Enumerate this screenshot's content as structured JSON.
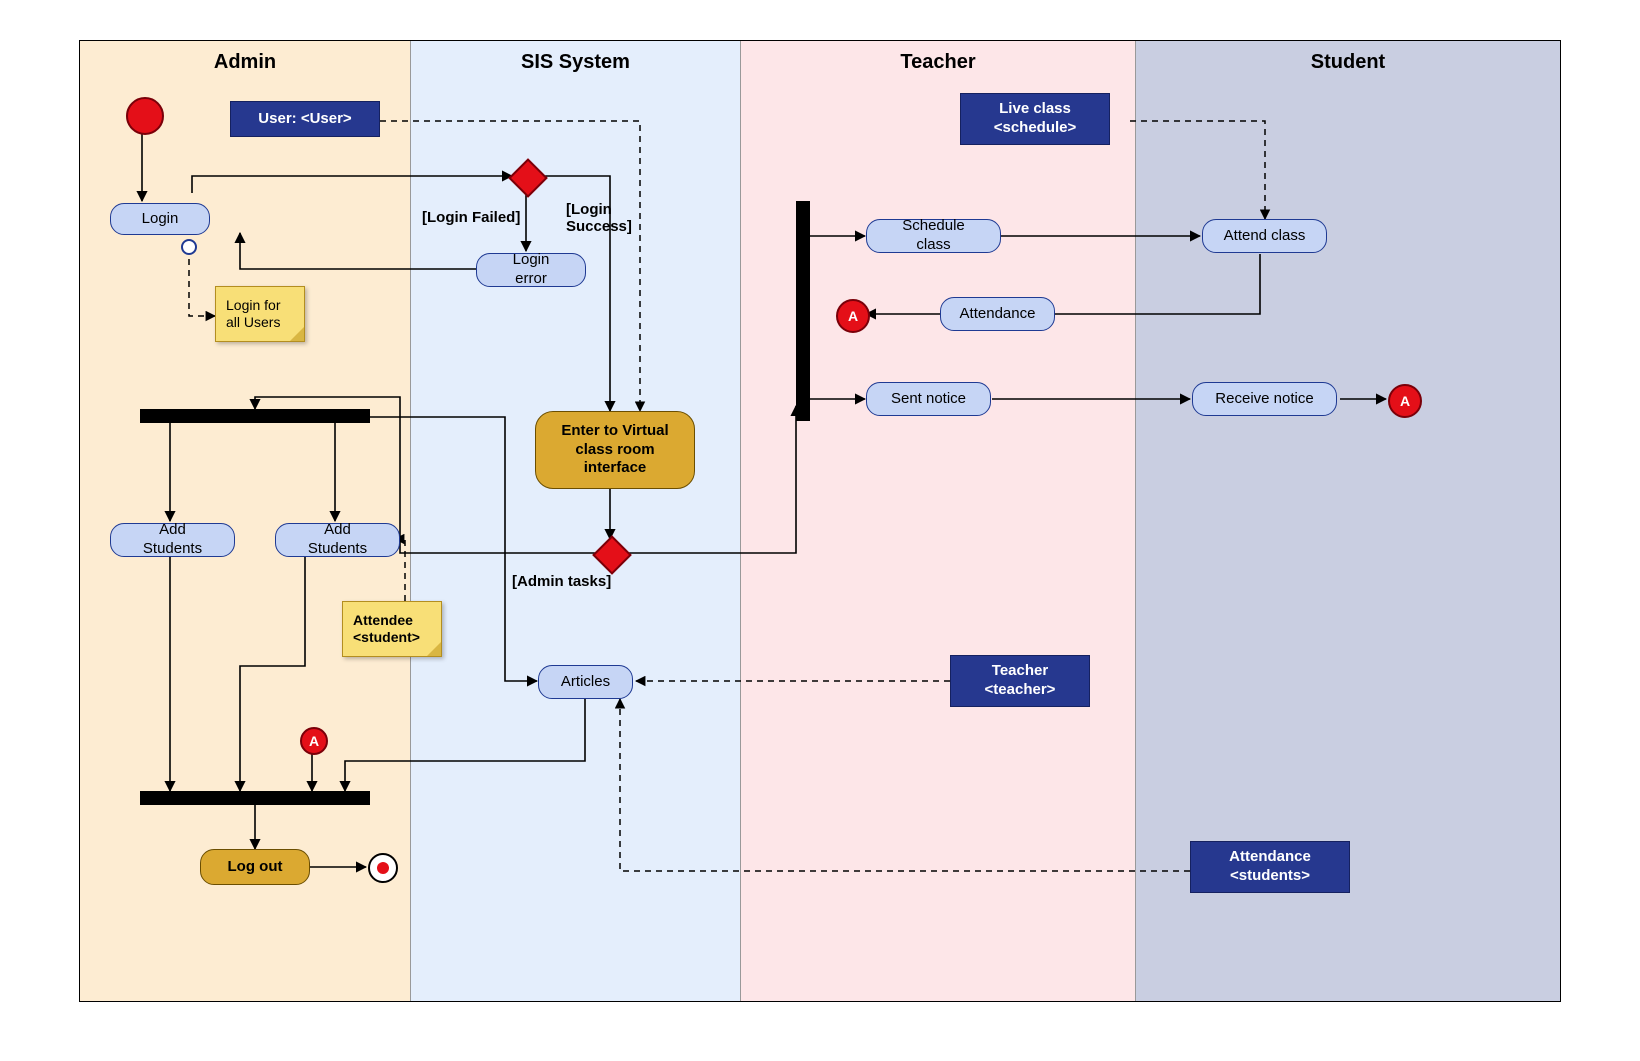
{
  "lanes": {
    "admin": {
      "title": "Admin"
    },
    "sis": {
      "title": "SIS System"
    },
    "teacher": {
      "title": "Teacher"
    },
    "student": {
      "title": "Student"
    }
  },
  "nodes": {
    "userBlock": "User: <User>",
    "login": "Login",
    "loginNote": "Login for all Users",
    "loginError": "Login error",
    "enterVirtual": "Enter to Virtual class room interface",
    "addStudents1": "Add Students",
    "addStudents2": "Add Students",
    "attendeeNote": "Attendee <student>",
    "articles": "Articles",
    "logout": "Log out",
    "liveClass": "Live class <schedule>",
    "scheduleClass": "Schedule class",
    "attendClass": "Attend class",
    "attendance": "Attendance",
    "sentNotice": "Sent notice",
    "receiveNotice": "Receive notice",
    "teacherBlock": "Teacher <teacher>",
    "attendanceBlock": "Attendance <students>",
    "connectorA": "A"
  },
  "labels": {
    "loginFailed": "[Login Failed]",
    "loginSuccess": "[Login Success]",
    "adminTasks": "[Admin tasks]"
  },
  "geometry": {
    "laneWidths": {
      "admin": 330,
      "sis": 330,
      "teacher": 395,
      "student": 425
    },
    "colors": {
      "laneAdmin": "#fdecd2",
      "laneSis": "#e4eefc",
      "laneTeacher": "#fde6e8",
      "laneStudent": "#c9cee1",
      "navy": "#26388f",
      "roundedBlue": "#c6d5f5",
      "gold": "#dba931",
      "red": "#e40f18"
    }
  }
}
